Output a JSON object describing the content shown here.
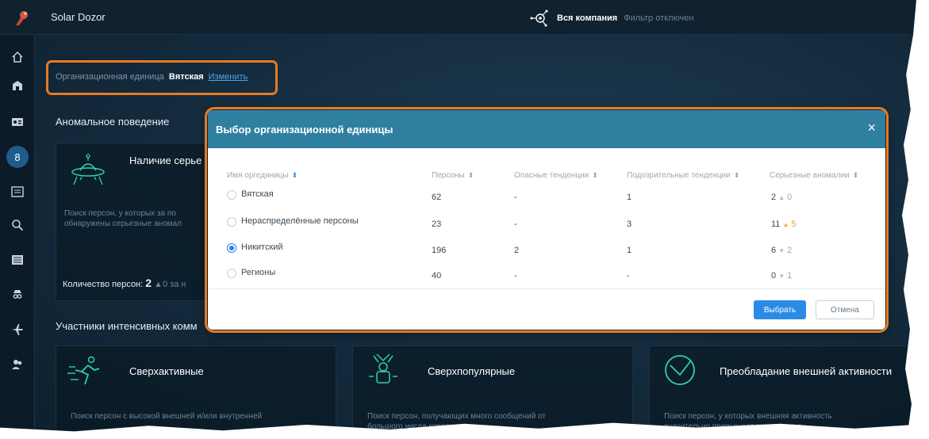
{
  "app": {
    "title": "Solar Dozor"
  },
  "header": {
    "company": "Вся компания",
    "filter_status": "Фильтр отключен"
  },
  "sidebar": {
    "icons": [
      "home-icon",
      "building-icon",
      "id-card-icon",
      "behavior-icon",
      "report-icon",
      "search-icon",
      "list-icon",
      "spy-icon",
      "plane-icon",
      "users-icon"
    ],
    "active_label": "8"
  },
  "org_unit": {
    "label": "Организационная единица",
    "value": "Вятская",
    "change": "Изменить"
  },
  "sections": {
    "anomalous": "Аномальное поведение",
    "intensive": "Участники интенсивных комм"
  },
  "card_serious": {
    "title": "Наличие серье",
    "desc_line1": "Поиск персон, у которых за по",
    "desc_line2": "обнаружены серьезные аномал",
    "count_label": "Количество персон:",
    "count_value": "2",
    "count_trend": "▲0 за н"
  },
  "bottom_cards": [
    {
      "title": "Сверхактивные",
      "desc_line1": "Поиск персон с высокой внешней и/или внутренней",
      "desc_line2": ""
    },
    {
      "title": "Сверхпопулярные",
      "desc_line1": "Поиск персон, получающих много сообщений от",
      "desc_line2": "большого числа коррес"
    },
    {
      "title": "Преобладание внешней активности",
      "desc_line1": "Поиск персон, у которых внешняя активность",
      "desc_line2": "значительно превышает внутреннюю"
    }
  ],
  "modal": {
    "title": "Выбор организационной единицы",
    "close": "×",
    "columns": [
      "Имя оргединицы",
      "Персоны",
      "Опасные тенденции",
      "Подозрительные тенденции",
      "Серьезные аномалии"
    ],
    "rows": [
      {
        "name": "Вятская",
        "persons": "62",
        "dangerous": "-",
        "suspicious": "1",
        "serious": "2",
        "trend": "▲",
        "trend_value": "0",
        "trend_kind": "up",
        "selected": false
      },
      {
        "name": "Нераспределённые персоны",
        "persons": "23",
        "dangerous": "-",
        "suspicious": "3",
        "serious": "11",
        "trend": "▲",
        "trend_value": "5",
        "trend_kind": "warn",
        "selected": false
      },
      {
        "name": "Никитский",
        "persons": "196",
        "dangerous": "2",
        "suspicious": "1",
        "serious": "6",
        "trend": "▼",
        "trend_value": "2",
        "trend_kind": "down",
        "selected": true
      },
      {
        "name": "Регионы",
        "persons": "40",
        "dangerous": "-",
        "suspicious": "-",
        "serious": "0",
        "trend": "▼",
        "trend_value": "1",
        "trend_kind": "down",
        "selected": false
      }
    ],
    "select_button": "Выбрать",
    "cancel_button": "Отмена"
  },
  "colors": {
    "accent": "#2a8be6",
    "highlight": "#e87a1e",
    "modal_header": "#2f7fa0",
    "warn": "#f5a623"
  }
}
